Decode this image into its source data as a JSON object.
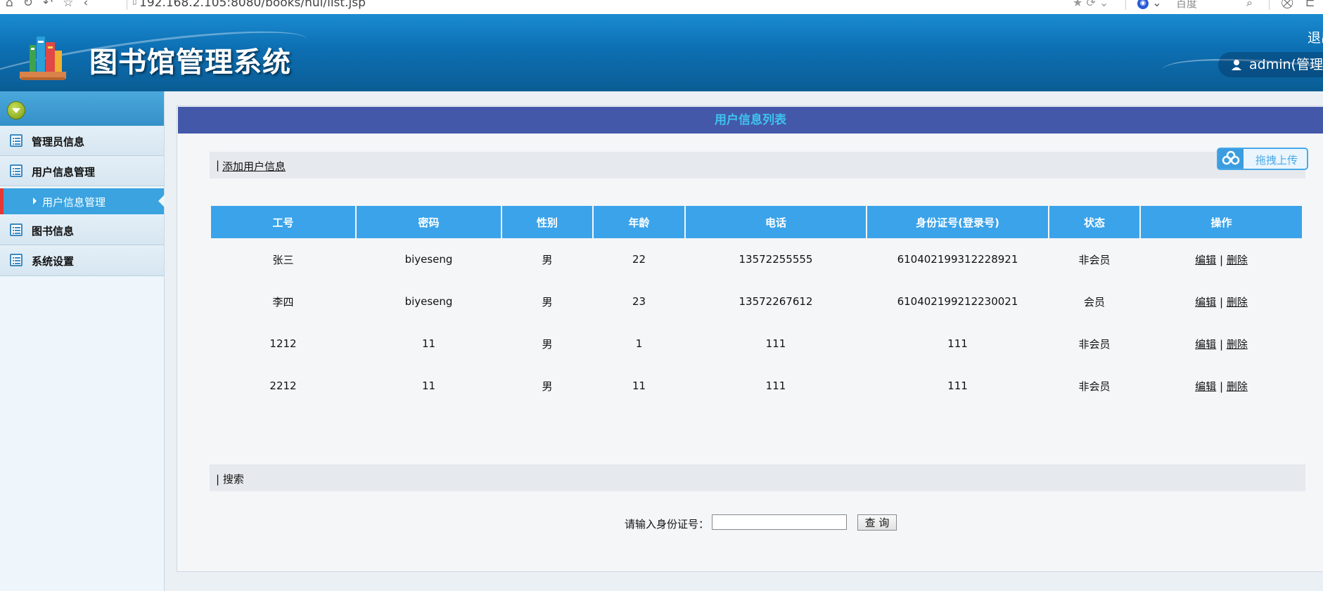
{
  "browser": {
    "url": "192.168.2.105:8080/books/hui/list.jsp",
    "search_engine": "百度"
  },
  "header": {
    "title": "图书馆管理系统",
    "logout": "退出",
    "user": "admin(管理员)"
  },
  "sidebar": {
    "items": [
      {
        "label": "管理员信息"
      },
      {
        "label": "用户信息管理"
      },
      {
        "label": "图书信息"
      },
      {
        "label": "系统设置"
      }
    ],
    "active_sub": "用户信息管理"
  },
  "main": {
    "panel_title": "用户信息列表",
    "add_prefix": "|",
    "add_link": "添加用户信息",
    "upload_label": "拖拽上传",
    "table": {
      "headers": [
        "工号",
        "密码",
        "性别",
        "年龄",
        "电话",
        "身份证号(登录号)",
        "状态",
        "操作"
      ],
      "rows": [
        [
          "张三",
          "biyeseng",
          "男",
          "22",
          "13572255555",
          "610402199312228921",
          "非会员"
        ],
        [
          "李四",
          "biyeseng",
          "男",
          "23",
          "13572267612",
          "610402199212230021",
          "会员"
        ],
        [
          "1212",
          "11",
          "男",
          "1",
          "111",
          "111",
          "非会员"
        ],
        [
          "2212",
          "11",
          "男",
          "11",
          "111",
          "111",
          "非会员"
        ]
      ],
      "edit_label": "编辑",
      "action_sep": "|",
      "delete_label": "删除"
    },
    "search_title": "| 搜索",
    "search_label": "请输入身份证号：",
    "search_value": "",
    "query_button": "查 询"
  },
  "colors": {
    "header_blue": "#0d6fb3",
    "title_bar": "#4458a9",
    "title_text": "#3ec3f0",
    "table_header": "#3aa3ea",
    "active_menu": "#3aa3e0",
    "active_marker": "#e53935"
  }
}
